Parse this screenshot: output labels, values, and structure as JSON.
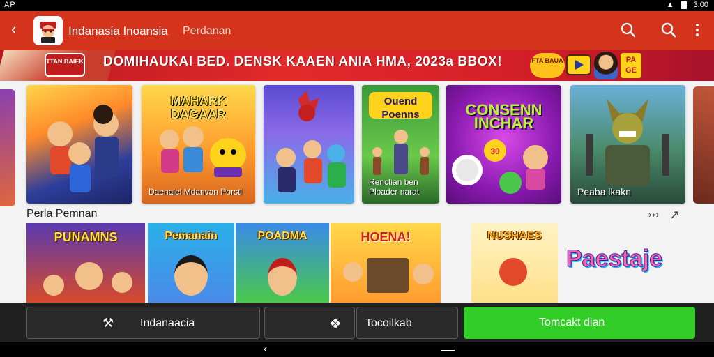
{
  "status_bar": {
    "left_text": "AP",
    "time": "3:00"
  },
  "app_bar": {
    "title": "Indanasia Inoansia",
    "subtitle": "Perdanan"
  },
  "banner": {
    "badge_text": "TTAN BAIEK",
    "headline": "DOMIHAUKAI BED. DENSK KAAEN ANIA HMA, 2023a BBOX!",
    "tag_text": "FTA BAUA",
    "right_badge": "PA GE"
  },
  "featured": [
    {
      "title": "",
      "label": ""
    },
    {
      "title": "MAHARK DAGAAR",
      "label": "Daenalel Mdanvan Porstl"
    },
    {
      "title": "",
      "label": ""
    },
    {
      "title": "Ouend Poenns",
      "label": "Renctian ben Ploader narat"
    },
    {
      "title": "CONSENN INCHAR",
      "label": ""
    },
    {
      "title": "",
      "label": "Peaba lkakn"
    }
  ],
  "section": {
    "title": "Perla Pemnan",
    "more_label": "›››"
  },
  "games": [
    {
      "title": "PUNAMNS"
    },
    {
      "title": "Pemanain"
    },
    {
      "title": "POADMA"
    },
    {
      "title": "HOENA!"
    },
    {
      "title": "NUSHAES"
    },
    {
      "title": "Paestaje"
    }
  ],
  "bottom_bar": {
    "share_label": "Indanaacia",
    "wishlist_label": "Tocoilkab",
    "install_label": "Tomcakt dian"
  },
  "colors": {
    "app_bar": "#d4331c",
    "install_button": "#32cd27",
    "panel": "#f3f3f3"
  }
}
